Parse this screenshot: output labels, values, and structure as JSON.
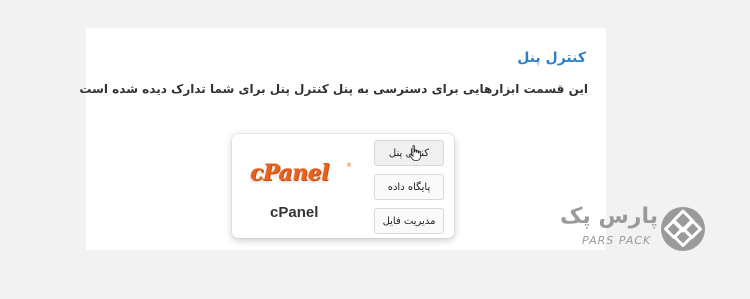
{
  "section": {
    "title": "کنترل پنل",
    "description": "این قسمت ابزارهایی برای دسترسی به پنل کنترل پنل برای شما تدارک دیده شده است"
  },
  "card": {
    "logo_text": "cPanel",
    "name": "cPanel",
    "buttons": {
      "control_panel": "کنترل پنل",
      "database": "پایگاه داده",
      "file_manager": "مدیریت فایل"
    }
  },
  "brand": {
    "name_fa": "پارس پک",
    "name_en": "PARS PACK"
  },
  "colors": {
    "title_blue": "#2f7fc8",
    "cpanel_orange": "#e8621f",
    "brand_gray": "#9a9a9a"
  },
  "icons": [
    "hand-pointer-icon",
    "parspack-logo-icon"
  ]
}
